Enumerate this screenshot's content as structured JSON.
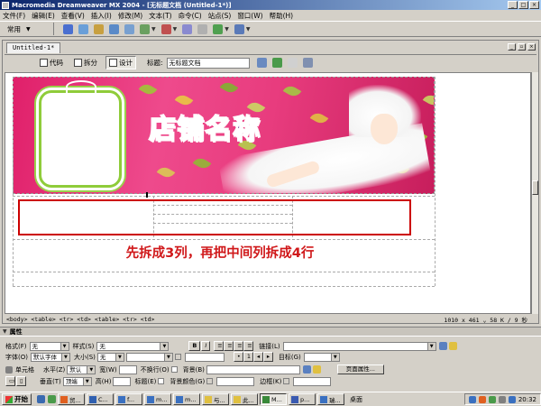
{
  "window": {
    "title": "Macromedia Dreamweaver MX 2004 - [无标题文档 (Untitled-1*)]",
    "min": "_",
    "max": "□",
    "close": "×"
  },
  "menu": [
    "文件(F)",
    "编辑(E)",
    "查看(V)",
    "插入(I)",
    "修改(M)",
    "文本(T)",
    "命令(C)",
    "站点(S)",
    "窗口(W)",
    "帮助(H)"
  ],
  "insert_bar": {
    "category": "常用"
  },
  "document": {
    "tab": "Untitled-1*",
    "views": {
      "code": "代码",
      "split": "拆分",
      "design": "设计"
    },
    "title_label": "标题:",
    "title_value": "无标题文档"
  },
  "canvas": {
    "shop_name": "店铺名称",
    "instruction": "先拆成3列，再把中间列拆成4行"
  },
  "status": {
    "tags": "<body> <table> <tr> <td> <table> <tr> <td>",
    "info": "1010 x 461 ⌄ 58 K / 9 秒"
  },
  "properties": {
    "title": "属性",
    "format_label": "格式(F)",
    "format_value": "无",
    "style_label": "样式(S)",
    "style_value": "无",
    "bold": "B",
    "italic": "I",
    "link_label": "链接(L)",
    "font_label": "字体(O)",
    "font_value": "默认字体",
    "size_label": "大小(S)",
    "size_value": "无",
    "target_label": "目标(G)",
    "cell_label": "单元格",
    "horz_label": "水平(Z)",
    "horz_value": "默认",
    "width_label": "宽(W)",
    "nowrap_label": "不换行(O)",
    "bg_label": "背景(B)",
    "page_props": "页面属性...",
    "vert_label": "垂直(T)",
    "vert_value": "顶端",
    "height_label": "高(H)",
    "header_label": "标题(E)",
    "bgcolor_label": "背景颜色(G)",
    "border_label": "边框(K)"
  },
  "taskbar": {
    "start": "开始",
    "tasks": [
      "贸...",
      "C...",
      "f...",
      "m...",
      "m...",
      "与...",
      "此...",
      "M...",
      "p...",
      "瑞..."
    ],
    "active_index": 7,
    "desktop": "桌面",
    "clock": "20:32"
  }
}
